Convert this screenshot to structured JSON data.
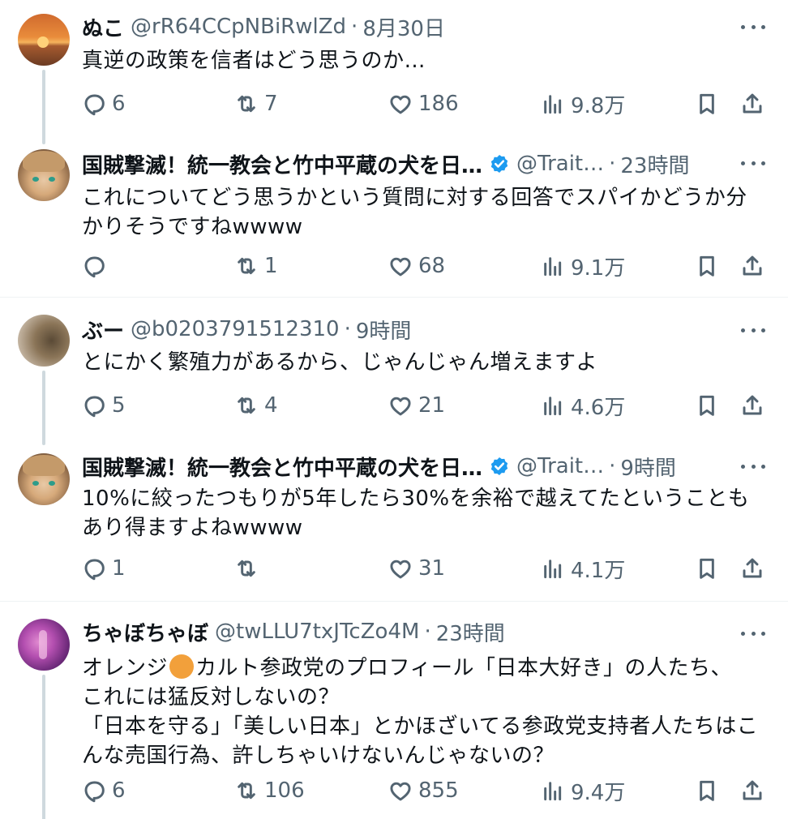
{
  "tweets": [
    {
      "name": "ぬこ",
      "handle": "@rR64CCpNBiRwlZd",
      "time": "8月30日",
      "text": "真逆の政策を信者はどう思うのか…",
      "replies": "6",
      "retweets": "7",
      "likes": "186",
      "views": "9.8万",
      "avatar_icon": "sunset-avatar"
    },
    {
      "name": "国賊撃滅！統一教会と竹中平蔵の犬を日…",
      "handle": "@Trait…",
      "verified": true,
      "time": "23時間",
      "text": "これについてどう思うかという質問に対する回答でスパイかどうか分かりそうですねwwww",
      "replies": "",
      "retweets": "1",
      "likes": "68",
      "views": "9.1万",
      "avatar_icon": "anime-character-avatar"
    },
    {
      "name": "ぶー",
      "handle": "@b0203791512310",
      "time": "9時間",
      "text": "とにかく繁殖力があるから、じゃんじゃん増えますよ",
      "replies": "5",
      "retweets": "4",
      "likes": "21",
      "views": "4.6万",
      "avatar_icon": "blurred-photo-avatar"
    },
    {
      "name": "国賊撃滅！統一教会と竹中平蔵の犬を日…",
      "handle": "@Trait…",
      "verified": true,
      "time": "9時間",
      "text": "10%に絞ったつもりが5年したら30%を余裕で越えてたということもあり得ますよねwwww",
      "replies": "1",
      "retweets": "",
      "likes": "31",
      "views": "4.1万",
      "avatar_icon": "anime-character-avatar"
    },
    {
      "name": "ちゃぼちゃぼ",
      "handle": "@twLLU7txJTcZo4M",
      "time": "23時間",
      "text_before_emoji": "オレンジ",
      "emoji": "orange-circle",
      "text_after_emoji": "カルト参政党のプロフィール「日本大好き」の人たち、\nこれには猛反対しないの？\n「日本を守る」「美しい日本」とかほざいてる参政党支持者人たちはこんな売国行為、許しちゃいけないんじゃないの？",
      "replies": "6",
      "retweets": "106",
      "likes": "855",
      "views": "9.4万",
      "avatar_icon": "purple-concert-avatar"
    }
  ],
  "colors": {
    "text": "#0f1419",
    "secondary": "#536471",
    "verified_blue": "#1d9bf0",
    "thread_line": "#cfd9de",
    "divider": "#eff3f4"
  }
}
